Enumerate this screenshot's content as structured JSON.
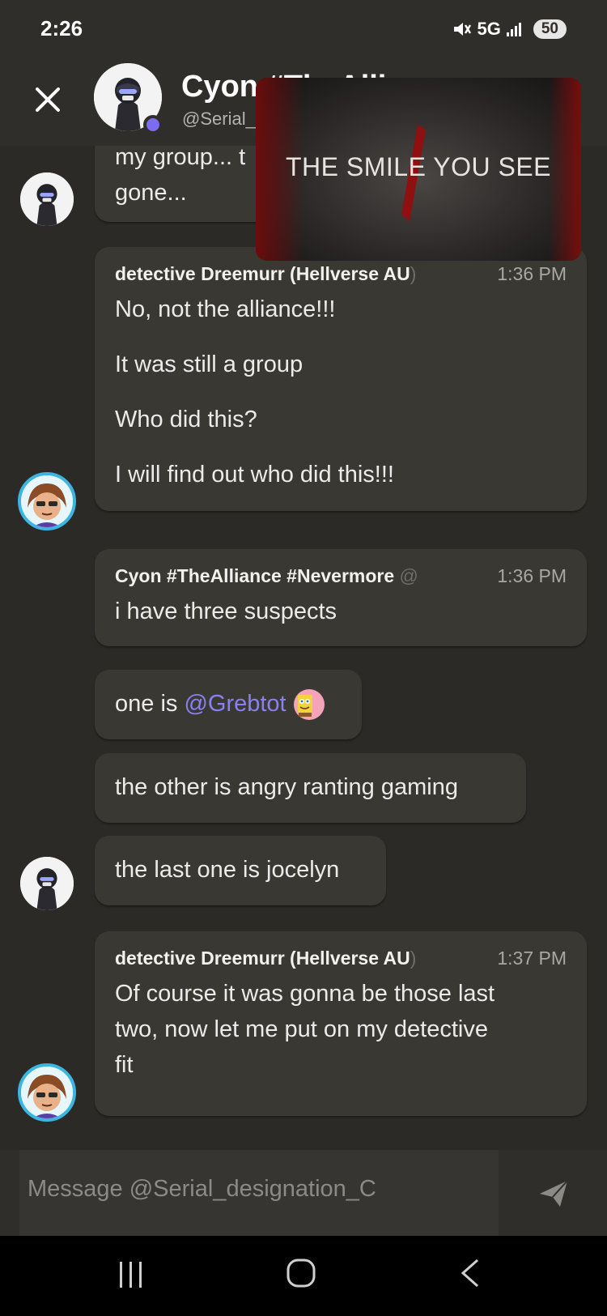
{
  "status_bar": {
    "time": "2:26",
    "network": "5G",
    "battery": "50"
  },
  "header": {
    "name": "Cyon #TheAlli",
    "username": "@Serial_"
  },
  "pip_video": {
    "caption": "THE SMILE YOU SEE"
  },
  "messages": [
    {
      "lines": [
        "my group... t",
        "gone..."
      ]
    },
    {
      "author": "detective Dreemurr (Hellverse AU",
      "author_tag": ")",
      "time": "1:36 PM",
      "lines": [
        "No, not the alliance!!!",
        "It was still a group",
        "Who did this?",
        "I will find out who did this!!!"
      ]
    },
    {
      "author": "Cyon #TheAlliance #Nevermore",
      "author_tag": "@",
      "time": "1:36 PM",
      "lines": [
        "i have three suspects"
      ]
    },
    {
      "prefix": "one is ",
      "mention": "@Grebtot"
    },
    {
      "lines": [
        "the other is angry ranting gaming"
      ]
    },
    {
      "lines": [
        "the last one is jocelyn"
      ]
    },
    {
      "author": "detective Dreemurr (Hellverse AU",
      "author_tag": ")",
      "time": "1:37 PM",
      "lines": [
        "Of course it was gonna be those last",
        "two, now let me put on my detective",
        "fit"
      ]
    }
  ],
  "composer": {
    "placeholder": "Message @Serial_designation_C"
  },
  "colors": {
    "background": "#2b2a27",
    "bubble": "#3a3833",
    "accent": "#7b6cf2",
    "mention": "#8a80f5"
  },
  "icons": [
    "close-icon",
    "mute-icon",
    "signal-icon",
    "send-icon",
    "nav-recent-icon",
    "nav-home-icon",
    "nav-back-icon"
  ]
}
